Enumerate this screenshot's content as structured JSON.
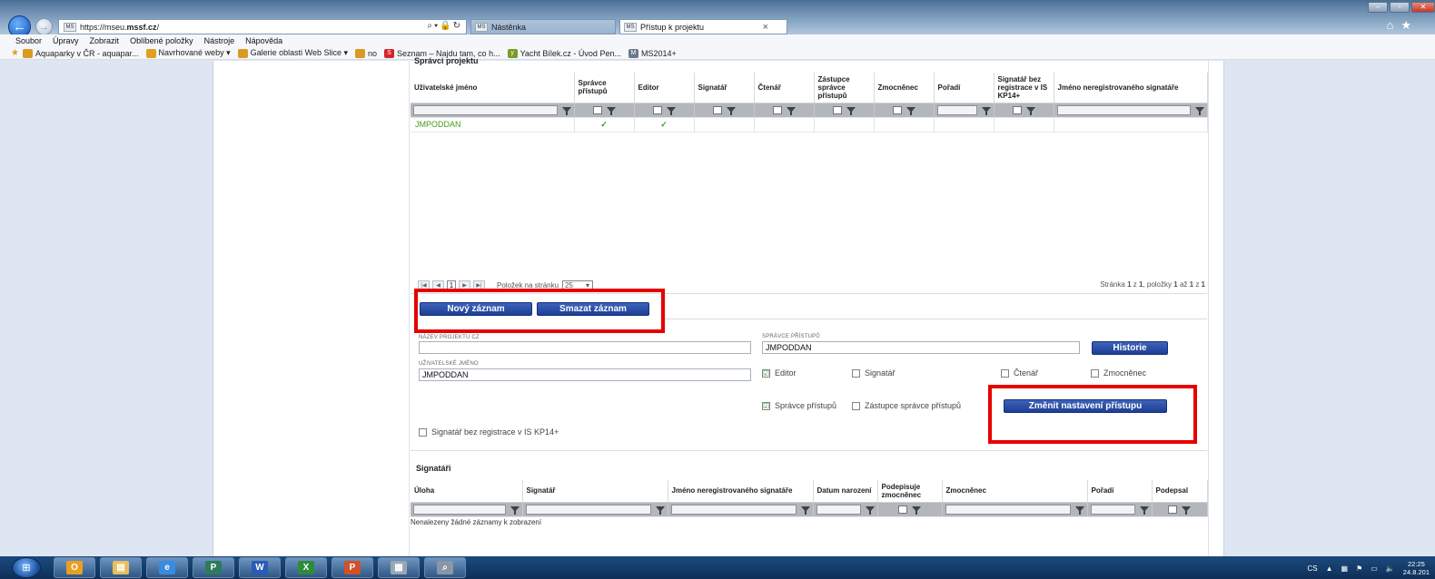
{
  "browser": {
    "url_prefix": "https://mseu.",
    "url_domain": "mssf.cz",
    "url_suffix": "/",
    "favicon_text": "MS",
    "tabs": [
      {
        "title": "Nástěnka"
      },
      {
        "title": "Přístup k projektu",
        "close": "×"
      }
    ],
    "menu": [
      "Soubor",
      "Úpravy",
      "Zobrazit",
      "Oblíbené položky",
      "Nástroje",
      "Nápověda"
    ],
    "favorites": [
      {
        "label": "Aquaparky v ČR - aquapar...",
        "color": "#d99a22"
      },
      {
        "label": "Navrhované weby ▾",
        "color": "#e0a020"
      },
      {
        "label": "Galerie oblasti Web Slice ▾",
        "color": "#d99a22"
      },
      {
        "label": "no",
        "color": "#d99a22"
      },
      {
        "label": "Seznam – Najdu tam, co h...",
        "color": "#d3242c"
      },
      {
        "label": "Yacht Bílek.cz - Úvod Pen...",
        "color": "#7a9a2a"
      },
      {
        "label": "MS2014+",
        "color": "#6b7a8a"
      }
    ]
  },
  "projekt_admins": {
    "section_title": "Správci projektu",
    "columns": [
      "Uživatelské jméno",
      "Správce přístupů",
      "Editor",
      "Signatář",
      "Čtenář",
      "Zástupce správce přístupů",
      "Zmocněnec",
      "Pořadí",
      "Signatář bez registrace v IS KP14+",
      "Jméno neregistrovaného signatáře"
    ],
    "rows": [
      {
        "username": "JMPODDAN",
        "spravce": "✓",
        "editor": "✓"
      }
    ],
    "pager": {
      "page": "1",
      "per_page_label": "Položek na stránku",
      "per_page": "25",
      "summary_pre": "Stránka",
      "page_cur": "1",
      "summary_of": "z",
      "page_total": "1",
      "summary_items": ", položky",
      "items_from": "1",
      "summary_to": "až",
      "items_to": "1",
      "summary_of2": "z",
      "items_total": "1"
    }
  },
  "actions": {
    "new_record": "Nový záznam",
    "delete_record": "Smazat záznam",
    "history": "Historie",
    "change_access": "Změnit nastavení přístupu"
  },
  "form": {
    "project_name_label": "Název projektu CZ",
    "project_name_value": "",
    "access_admin_label": "Správce přístupů",
    "access_admin_value": "JMPODDAN",
    "username_label": "Uživatelské jméno",
    "username_value": "JMPODDAN",
    "checkboxes": {
      "editor": {
        "label": "Editor",
        "checked": "☑"
      },
      "signatar": {
        "label": "Signatář",
        "checked": ""
      },
      "ctenar": {
        "label": "Čtenář",
        "checked": ""
      },
      "zmocnenec": {
        "label": "Zmocněnec",
        "checked": ""
      },
      "spravce": {
        "label": "Správce přístupů",
        "checked": "☑"
      },
      "zastupce": {
        "label": "Zástupce správce přístupů",
        "checked": ""
      },
      "bez_registrace": {
        "label": "Signatář bez registrace v IS KP14+",
        "checked": ""
      }
    }
  },
  "signatari": {
    "section_title": "Signatáři",
    "columns": [
      "Úloha",
      "Signatář",
      "Jméno neregistrovaného signatáře",
      "Datum narození",
      "Podepisuje zmocněnec",
      "Zmocněnec",
      "Pořadí",
      "Podepsal"
    ],
    "empty_text": "Nenalezeny žádné záznamy k zobrazení"
  },
  "taskbar": {
    "apps": [
      {
        "label": "O",
        "color": "#e8a020"
      },
      {
        "label": "▤",
        "color": "#e6c060"
      },
      {
        "label": "e",
        "color": "#3a8ae0"
      },
      {
        "label": "P",
        "color": "#2f7a5a"
      },
      {
        "label": "W",
        "color": "#2a5bb8"
      },
      {
        "label": "X",
        "color": "#2f8a3a"
      },
      {
        "label": "P",
        "color": "#d2502a"
      },
      {
        "label": "▦",
        "color": "#9aa6b4"
      },
      {
        "label": "⌕",
        "color": "#8a96a8"
      }
    ],
    "lang": "CS",
    "time": "22:25",
    "date": "24.8.201"
  },
  "colors": {
    "accent_blue": "#1d3f96",
    "highlight_red": "#e60000",
    "link_green": "#4a9b1e"
  }
}
